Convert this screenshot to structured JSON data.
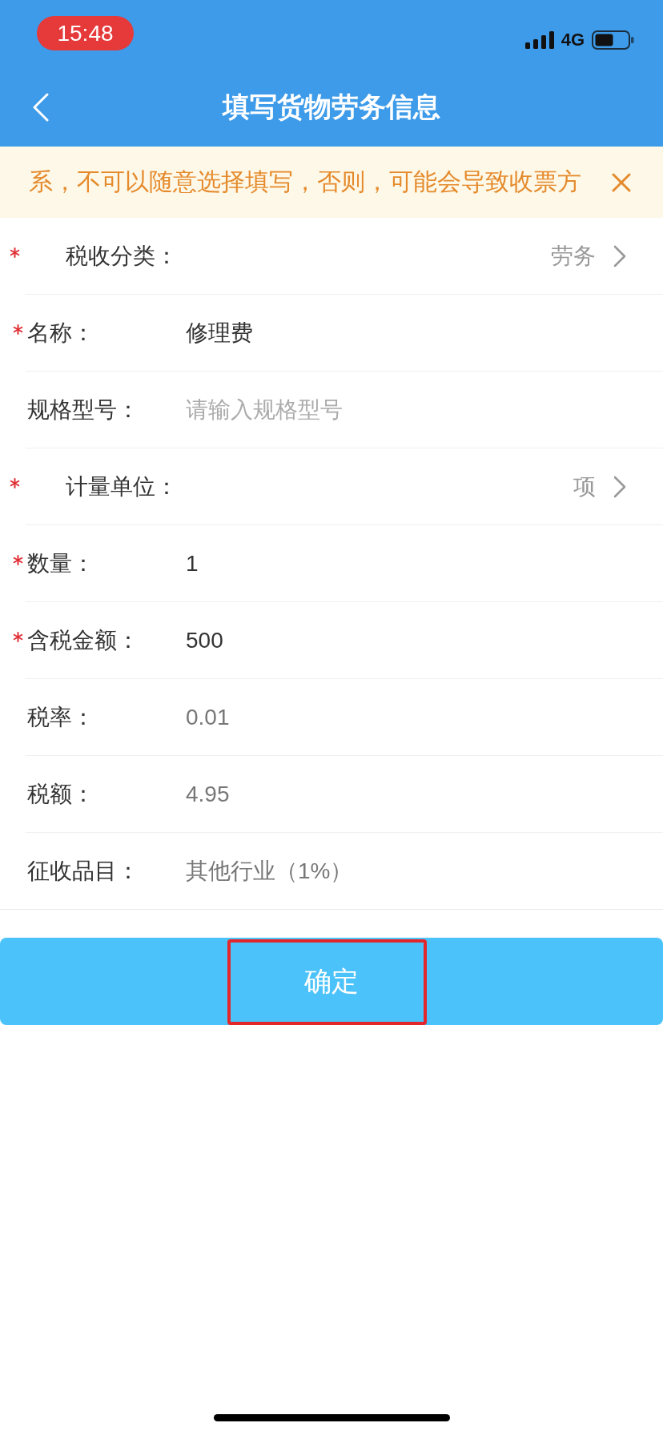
{
  "status_bar": {
    "time": "15:48",
    "network": "4G"
  },
  "nav_bar": {
    "title": "填写货物劳务信息"
  },
  "notice": {
    "text": "系，不可以随意选择填写，否则，可能会导致收票方"
  },
  "form": {
    "rows": [
      {
        "kind": "picker",
        "label": "税收分类：",
        "required": true,
        "value": "劳务"
      },
      {
        "kind": "input",
        "label": "名称：",
        "required": true,
        "value": "修理费",
        "disabled": false
      },
      {
        "kind": "input",
        "label": "规格型号：",
        "required": false,
        "placeholder": "请输入规格型号",
        "disabled": false
      },
      {
        "kind": "picker",
        "label": "计量单位：",
        "required": true,
        "value": "项"
      },
      {
        "kind": "input",
        "label": "数量：",
        "required": true,
        "value": "1",
        "disabled": false
      },
      {
        "kind": "input",
        "label": "含税金额：",
        "required": true,
        "value": "500",
        "disabled": false
      },
      {
        "kind": "input",
        "label": "税率：",
        "required": false,
        "value": "0.01",
        "disabled": true
      },
      {
        "kind": "input",
        "label": "税额：",
        "required": false,
        "value": "4.95",
        "disabled": true
      },
      {
        "kind": "input",
        "label": "征收品目：",
        "required": false,
        "value": "其他行业（1%）",
        "disabled": true
      }
    ]
  },
  "confirm_button": {
    "label": "确定",
    "highlighted": true
  }
}
